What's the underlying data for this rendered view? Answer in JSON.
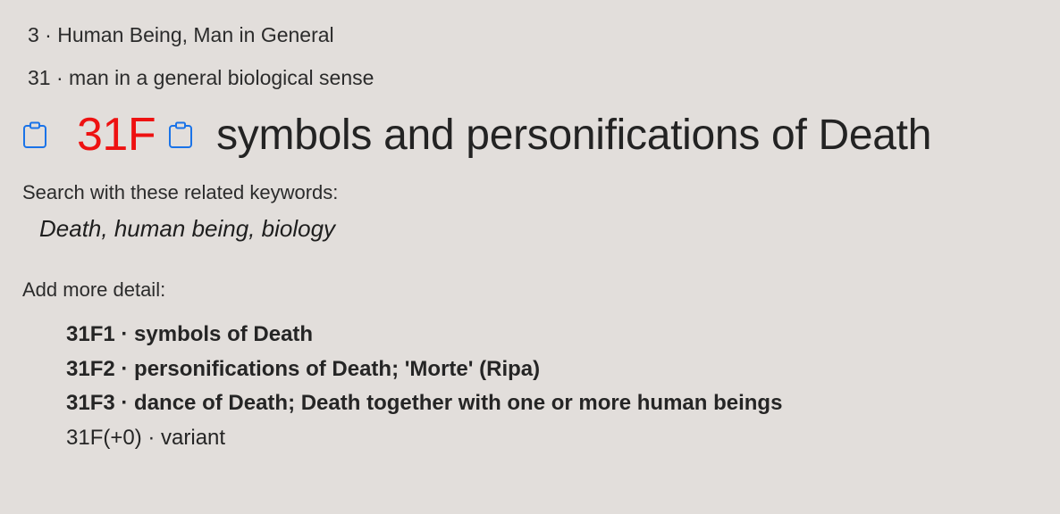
{
  "breadcrumbs": [
    {
      "code": "3",
      "label": "Human Being, Man in General"
    },
    {
      "code": "31",
      "label": "man in a general biological sense"
    }
  ],
  "title": {
    "notation": "31F",
    "text": "symbols and personifications of Death",
    "notation_color": "#ee1111",
    "icons": [
      "clipboard-icon",
      "clipboard-icon"
    ],
    "icon_color": "#1a73e8"
  },
  "keywords_section": {
    "label": "Search with these related keywords:",
    "keywords": [
      "Death,",
      "human being,",
      "biology"
    ]
  },
  "detail_section": {
    "label": "Add more detail:",
    "items": [
      {
        "text": "31F1 · symbols of Death",
        "bold": true
      },
      {
        "text": "31F2 · personifications of Death; 'Morte' (Ripa)",
        "bold": true
      },
      {
        "text": "31F3 · dance of Death; Death together with one or more human beings",
        "bold": true
      },
      {
        "text": "31F(+0) · variant",
        "bold": false
      }
    ]
  },
  "separator": " · "
}
